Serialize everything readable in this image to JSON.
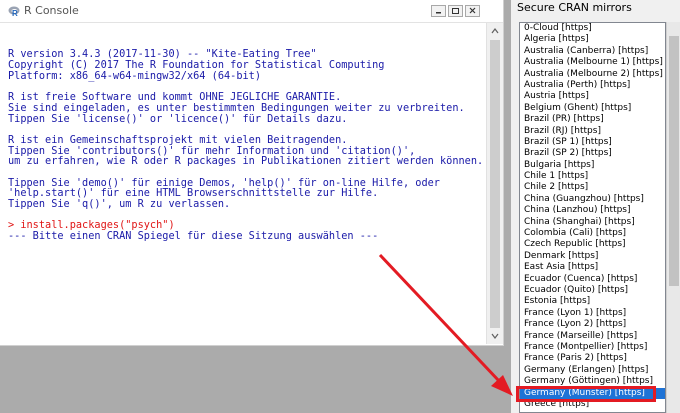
{
  "rconsole": {
    "title": "R Console",
    "lines": [
      {
        "text": "",
        "type": "out"
      },
      {
        "text": "",
        "type": "out"
      },
      {
        "text": "R version 3.4.3 (2017-11-30) -- \"Kite-Eating Tree\"",
        "type": "out"
      },
      {
        "text": "Copyright (C) 2017 The R Foundation for Statistical Computing",
        "type": "out"
      },
      {
        "text": "Platform: x86_64-w64-mingw32/x64 (64-bit)",
        "type": "out"
      },
      {
        "text": "",
        "type": "out"
      },
      {
        "text": "R ist freie Software und kommt OHNE JEGLICHE GARANTIE.",
        "type": "out"
      },
      {
        "text": "Sie sind eingeladen, es unter bestimmten Bedingungen weiter zu verbreiten.",
        "type": "out"
      },
      {
        "text": "Tippen Sie 'license()' or 'licence()' für Details dazu.",
        "type": "out"
      },
      {
        "text": "",
        "type": "out"
      },
      {
        "text": "R ist ein Gemeinschaftsprojekt mit vielen Beitragenden.",
        "type": "out"
      },
      {
        "text": "Tippen Sie 'contributors()' für mehr Information und 'citation()',",
        "type": "out"
      },
      {
        "text": "um zu erfahren, wie R oder R packages in Publikationen zitiert werden können.",
        "type": "out"
      },
      {
        "text": "",
        "type": "out"
      },
      {
        "text": "Tippen Sie 'demo()' für einige Demos, 'help()' für on-line Hilfe, oder",
        "type": "out"
      },
      {
        "text": "'help.start()' für eine HTML Browserschnittstelle zur Hilfe.",
        "type": "out"
      },
      {
        "text": "Tippen Sie 'q()', um R zu verlassen.",
        "type": "out"
      },
      {
        "text": "",
        "type": "out"
      },
      {
        "text": "> install.packages(\"psych\")",
        "type": "cmd"
      },
      {
        "text": "--- Bitte einen CRAN Spiegel für diese Sitzung auswählen ---",
        "type": "out"
      }
    ]
  },
  "cran": {
    "title": "Secure CRAN mirrors",
    "selected_index": 34,
    "mirrors": [
      "0-Cloud [https]",
      "Algeria [https]",
      "Australia (Canberra) [https]",
      "Australia (Melbourne 1) [https]",
      "Australia (Melbourne 2) [https]",
      "Australia (Perth) [https]",
      "Austria [https]",
      "Belgium (Ghent) [https]",
      "Brazil (PR) [https]",
      "Brazil (RJ) [https]",
      "Brazil (SP 1) [https]",
      "Brazil (SP 2) [https]",
      "Bulgaria [https]",
      "Chile 1 [https]",
      "Chile 2 [https]",
      "China (Guangzhou) [https]",
      "China (Lanzhou) [https]",
      "China (Shanghai) [https]",
      "Colombia (Cali) [https]",
      "Czech Republic [https]",
      "Denmark [https]",
      "East Asia [https]",
      "Ecuador (Cuenca) [https]",
      "Ecuador (Quito) [https]",
      "Estonia [https]",
      "France (Lyon 1) [https]",
      "France (Lyon 2) [https]",
      "France (Marseille) [https]",
      "France (Montpellier) [https]",
      "France (Paris 2) [https]",
      "Germany (Erlangen) [https]",
      "Germany (Göttingen) [https]",
      "Germany (Münster) [https]",
      "Greece [https]"
    ]
  },
  "colors": {
    "console_text": "#1a1aa8",
    "command_text": "#e01515",
    "selection_bg": "#1e73d6",
    "highlight": "#e31b23"
  }
}
